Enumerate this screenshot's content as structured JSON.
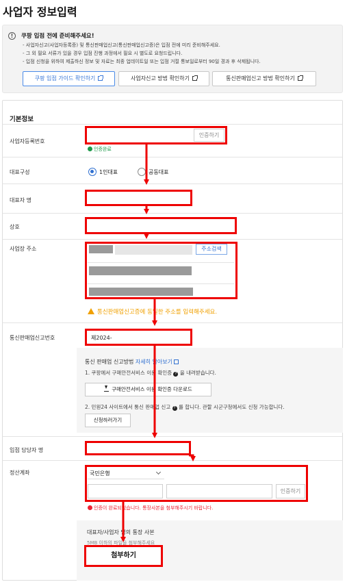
{
  "page": {
    "title": "사업자 정보입력"
  },
  "notice": {
    "title": "쿠팡 입점 전에 준비해주세요!",
    "lines": [
      "- 사업자신고(사업자등록증) 및 통신판매업신고(통신판매업신고증)은 입점 전에 미리 준비해주세요.",
      "- 그 외 필요 서류가 있을 경우 입점 진행 과정에서 필요 시 별도로 요청드립니다.",
      "- 입점 신청을 위하여 제출하신 정보 및 자료는 최종 업데이트일 또는 입점 거절 통보일로부터 90일 경과 후 삭제됩니다."
    ],
    "buttons": [
      "쿠팡 입점 가이드 확인하기",
      "사업자신고 방법 확인하기",
      "통신판매업신고 방법 확인하기"
    ]
  },
  "form": {
    "section_title": "기본정보",
    "biz_reg": {
      "label": "사업자등록번호",
      "value": "",
      "verify_button": "인증하기",
      "status": "인증완료"
    },
    "rep_type": {
      "label": "대표구성",
      "options": [
        "1인대표",
        "공동대표"
      ],
      "selected": "1인대표"
    },
    "rep_name": {
      "label": "대표자 명",
      "value": ""
    },
    "company": {
      "label": "상호",
      "value": ""
    },
    "address": {
      "label": "사업장 주소",
      "search_button": "주소검색",
      "warning": "통신판매업신고증에 동일한 주소를 입력해주세요."
    },
    "ecom_reg": {
      "label": "통신판매업신고번호",
      "value": "제2024-"
    },
    "guide": {
      "title": "통신 판매업 신고방법",
      "link": "자세히 알아보기",
      "step1_pre": "1. 쿠팡에서 구매안전서비스 이용 확인증",
      "step1_post": "을 내려받습니다.",
      "download_button": "구매안전서비스 이용 확인증 다운로드",
      "step2_pre": "2. 민원24 사이트에서 통신 판매업 신고",
      "step2_post": "를 합니다. 관할 시군구청에서도 신청 가능합니다.",
      "apply_button": "신청하러가기"
    },
    "manager": {
      "label": "입점 담당자 명",
      "value": ""
    },
    "settlement": {
      "label": "정산계좌",
      "bank": "국민은행",
      "verify_button": "인증하기",
      "error": "인증이 완료되었습니다. 통장사본을 첨부해주시기 바랍니다."
    },
    "attach": {
      "title": "대표자/사업자 명의 통장 사본",
      "hint": "5MB 이하의 파일을 첨부해주세요",
      "button": "첨부하기"
    }
  },
  "colors": {
    "highlight": "#ee0000",
    "accent": "#2f6fd0",
    "warning": "#f0a000",
    "success": "#1e9a4a"
  }
}
